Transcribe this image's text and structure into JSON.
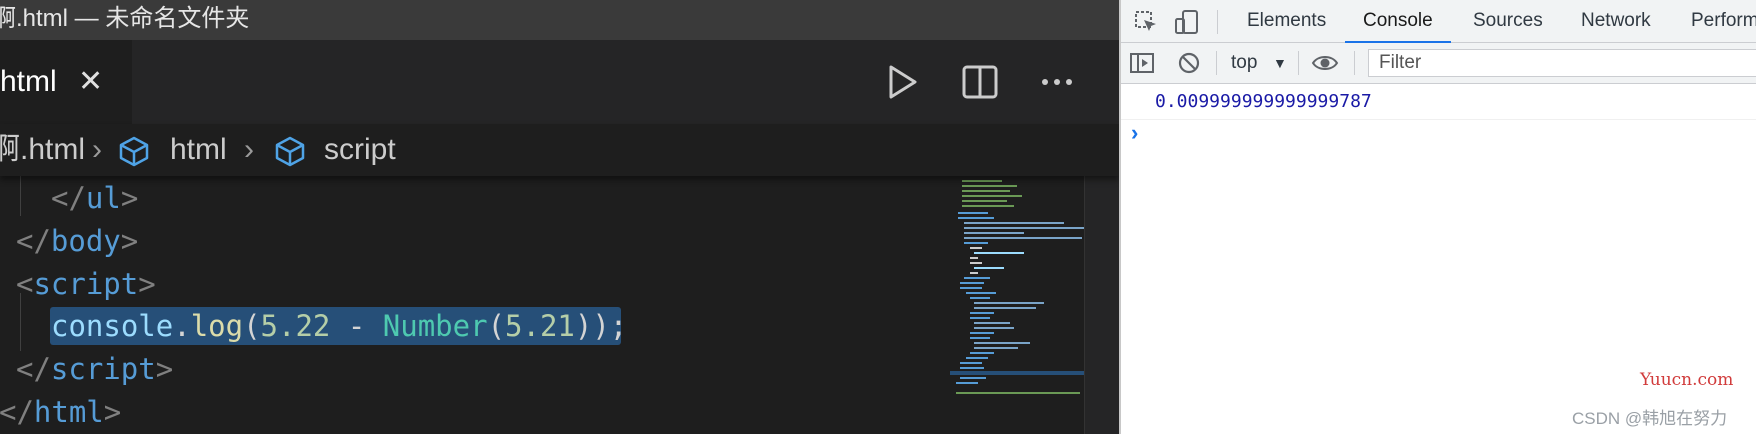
{
  "editor": {
    "window_title": "啊.html — 未命名文件夹",
    "tab": {
      "label": "html",
      "close": "✕"
    },
    "actions": {
      "run_icon": "play-icon",
      "split_icon": "split-editor-icon",
      "more": "···"
    },
    "breadcrumb": {
      "file": "啊.html",
      "sep1": "›",
      "item1": "html",
      "sep2": "›",
      "item2": "script"
    },
    "code": {
      "l1_open": "</",
      "l1_tag": "ul",
      "l1_close": ">",
      "l2_open": "</",
      "l2_tag": "body",
      "l2_close": ">",
      "l3_open": "<",
      "l3_tag": "script",
      "l3_close": ">",
      "l4_obj": "console",
      "l4_dot": ".",
      "l4_fn": "log",
      "l4_p1": "(",
      "l4_n1": "5.22",
      "l4_sp1": " ",
      "l4_op": "-",
      "l4_sp2": " ",
      "l4_cls": "Number",
      "l4_p2": "(",
      "l4_n2": "5.21",
      "l4_end": "));",
      "l5_open": "</",
      "l5_tag": "script",
      "l5_close": ">",
      "l6_open": "</",
      "l6_tag": "html",
      "l6_close": ">"
    }
  },
  "devtools": {
    "tabs": [
      "Elements",
      "Console",
      "Sources",
      "Network",
      "Perform"
    ],
    "active_tab": "Console",
    "context": "top",
    "filter_placeholder": "Filter",
    "output": "0.009999999999999787",
    "prompt": "›"
  },
  "watermarks": {
    "site": "Yuucn.com",
    "author": "CSDN @韩旭在努力"
  },
  "colors": {
    "editor_bg": "#1e1e1e",
    "selection": "#264f78",
    "accent": "#1a73e8",
    "console_number": "#1a1aa6"
  }
}
